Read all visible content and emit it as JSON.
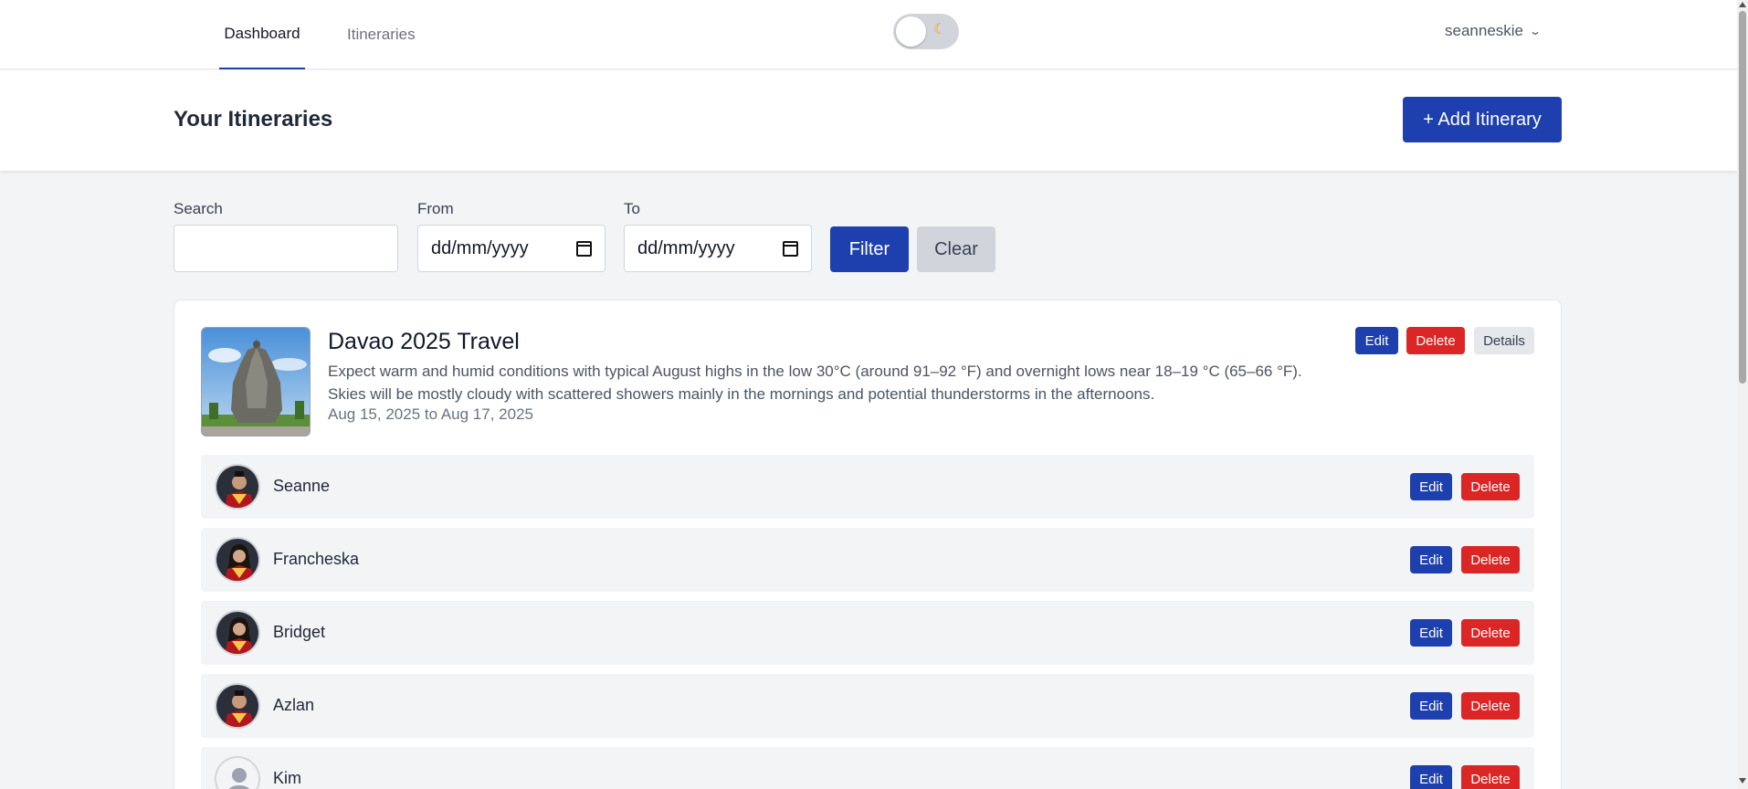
{
  "nav": {
    "tabs": [
      {
        "label": "Dashboard",
        "active": true
      },
      {
        "label": "Itineraries",
        "active": false
      }
    ],
    "theme_toggle_icon": "moon-icon",
    "username": "seanneskie"
  },
  "header": {
    "title": "Your Itineraries",
    "add_button": "+ Add Itinerary"
  },
  "filters": {
    "search_label": "Search",
    "search_value": "",
    "from_label": "From",
    "from_placeholder": "dd/mm/yyyy",
    "to_label": "To",
    "to_placeholder": "dd/mm/yyyy",
    "filter_button": "Filter",
    "clear_button": "Clear"
  },
  "itinerary": {
    "title": "Davao 2025 Travel",
    "description": "Expect warm and humid conditions with typical August highs in the low 30°C (around 91–92 °F) and overnight lows near 18–19 °C (65–66 °F). Skies will be mostly cloudy with scattered showers mainly in the mornings and potential thunderstorms in the afternoons.",
    "dates": "Aug 15, 2025 to Aug 17, 2025",
    "edit": "Edit",
    "delete": "Delete",
    "details": "Details"
  },
  "participants": [
    {
      "name": "Seanne",
      "edit": "Edit",
      "delete": "Delete"
    },
    {
      "name": "Francheska",
      "edit": "Edit",
      "delete": "Delete"
    },
    {
      "name": "Bridget",
      "edit": "Edit",
      "delete": "Delete"
    },
    {
      "name": "Azlan",
      "edit": "Edit",
      "delete": "Delete"
    },
    {
      "name": "Kim",
      "edit": "Edit",
      "delete": "Delete"
    }
  ],
  "colors": {
    "primary": "#1e3fae",
    "danger": "#dc2626",
    "neutral": "#e5e7eb"
  }
}
